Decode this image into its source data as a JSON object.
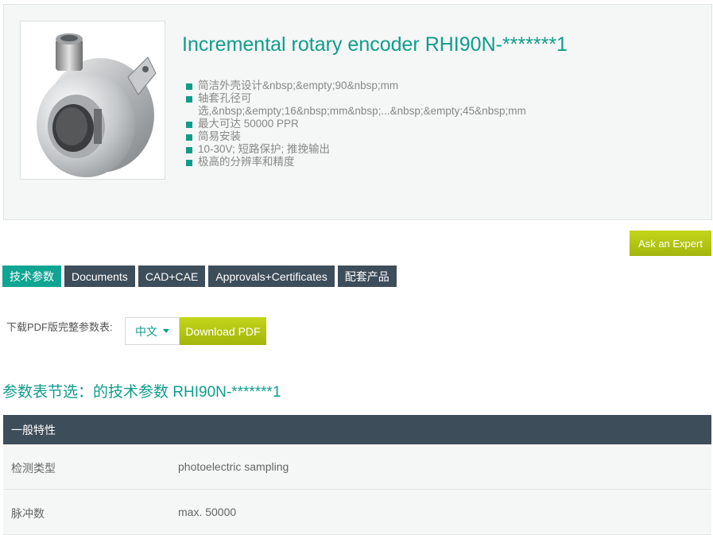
{
  "product": {
    "title": "Incremental rotary encoder RHI90N-*******1",
    "image_alt": "rotary encoder photo",
    "features": [
      "简洁外壳设计&nbsp;&empty;90&nbsp;mm",
      "轴套孔径可选,&nbsp;&empty;16&nbsp;mm&nbsp;...&nbsp;&empty;45&nbsp;mm",
      "最大可达 50000 PPR",
      "简易安装",
      "10-30V; 短路保护; 推挽输出",
      "极高的分辨率和精度"
    ]
  },
  "actions": {
    "ask_expert_label": "Ask an Expert"
  },
  "tabs": [
    {
      "label": "技术参数",
      "active": true
    },
    {
      "label": "Documents",
      "active": false
    },
    {
      "label": "CAD+CAE",
      "active": false
    },
    {
      "label": "Approvals+Certificates",
      "active": false
    },
    {
      "label": "配套产品",
      "active": false
    }
  ],
  "download": {
    "label": "下载PDF版完整参数表:",
    "language": "中文",
    "button_label": "Download PDF"
  },
  "section": {
    "heading": "参数表节选：的技术参数 RHI90N-*******1"
  },
  "spec_table": {
    "group": "一般特性",
    "rows": [
      {
        "label": "检测类型",
        "value": "photoelectric sampling"
      },
      {
        "label": "脉冲数",
        "value": "max. 50000"
      }
    ]
  },
  "colors": {
    "accent": "#0f9d8c",
    "tab_bg": "#3e4d5a",
    "button_lime": "#b4c614"
  }
}
